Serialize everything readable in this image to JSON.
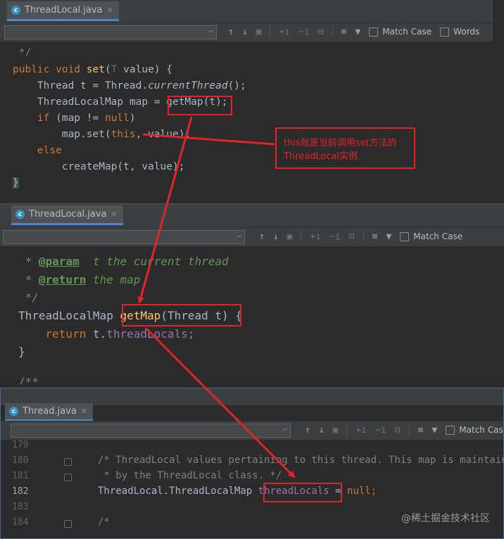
{
  "panel1": {
    "tab": {
      "icon_letter": "c",
      "label": "ThreadLocal.java",
      "close": "✕"
    },
    "search": {
      "return_glyph": "⏎"
    },
    "toolbar": {
      "match_case": "Match Case",
      "words": "Words"
    },
    "code": [
      " */",
      "public void set(T value) {",
      "    Thread t = Thread.currentThread();",
      "    ThreadLocalMap map = getMap(t);",
      "    if (map != null)",
      "        map.set(this, value);",
      "    else",
      "        createMap(t, value);",
      "}"
    ]
  },
  "panel2": {
    "tab": {
      "icon_letter": "c",
      "label": "ThreadLocal.java",
      "close": "✕"
    },
    "search": {
      "return_glyph": "⏎"
    },
    "toolbar": {
      "match_case": "Match Case"
    },
    "code": {
      "param_tag": "@param",
      "param_text": "  t the current thread",
      "return_tag": "@return",
      "return_text": " the map",
      "close": " */",
      "sig_type": "ThreadLocalMap ",
      "sig_name": "getMap",
      "sig_args": "(Thread t) {",
      "ret_kw": "return ",
      "ret_obj": "t.",
      "ret_field": "threadLocals",
      "ret_end": ";",
      "brace": "}",
      "dots": "/**"
    }
  },
  "panel3": {
    "tab": {
      "icon_letter": "c",
      "label": "Thread.java",
      "close": "✕"
    },
    "search": {
      "return_glyph": "⏎"
    },
    "toolbar": {
      "match_case": "Match Case"
    },
    "line_numbers": [
      "179",
      "180",
      "181",
      "182",
      "183",
      "184"
    ],
    "code": {
      "c1": "/* ThreadLocal values pertaining to this thread. This map is maintained",
      "c2": " * by the ThreadLocal class. */",
      "decl_type": "ThreadLocal.ThreadLocalMap ",
      "decl_field": "threadLocals",
      "decl_eq": " = ",
      "decl_null": "null",
      "decl_end": ";",
      "c3": "/*"
    }
  },
  "annotation": {
    "line1": "this就是当前调用set方法的",
    "line2": "ThreadLocal实例",
    "color": "#e0242b"
  },
  "watermark": "@稀土掘金技术社区"
}
